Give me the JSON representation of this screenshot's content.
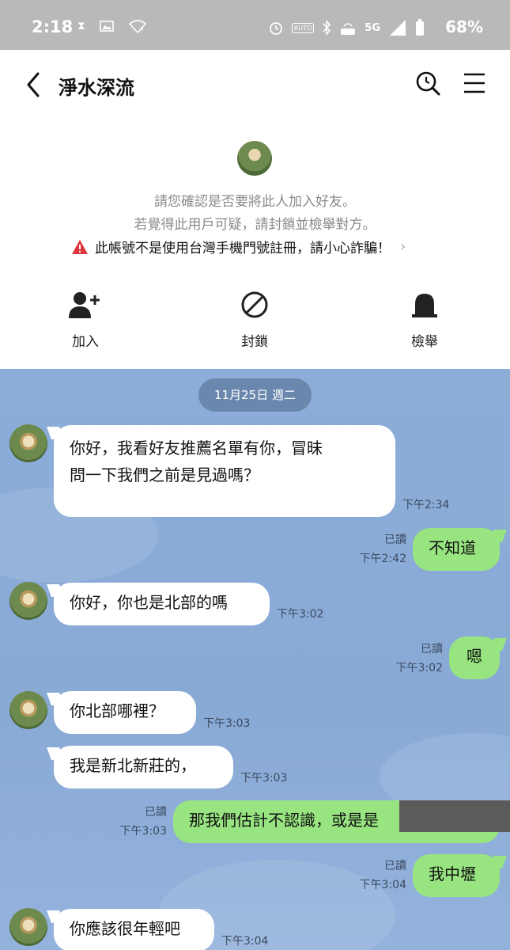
{
  "status_bar": {
    "time": "2:18",
    "battery": "68%",
    "icons": [
      "hourglass-icon",
      "image-icon",
      "wifi-question-icon",
      "alarm-icon",
      "auto-icon",
      "bluetooth-icon",
      "volte-icon",
      "5g-icon",
      "signal-icon",
      "battery-icon"
    ],
    "auto_label": "AUTO",
    "net_label": "5G"
  },
  "header": {
    "title": "淨水深流"
  },
  "friend_panel": {
    "confirm_line1": "請您確認是否要將此人加入好友。",
    "confirm_line2": "若覺得此用戶可疑，請封鎖並檢舉對方。",
    "warning": "此帳號不是使用台灣手機門號註冊，請小心詐騙！",
    "actions": [
      {
        "label": "加入",
        "icon": "add-friend-icon"
      },
      {
        "label": "封鎖",
        "icon": "block-icon"
      },
      {
        "label": "檢舉",
        "icon": "report-icon"
      }
    ]
  },
  "chat": {
    "date": "11月25日 週二",
    "messages": [
      {
        "side": "in",
        "text_line1": "你好，我看好友推薦名單有你，冒昧",
        "text_line2": "問一下我們之前是見過嗎？",
        "time": "下午2:34"
      },
      {
        "side": "out",
        "text": "不知道",
        "read": "已讀",
        "time": "下午2:42"
      },
      {
        "side": "in",
        "text": "你好，你也是北部的嗎",
        "time": "下午3:02"
      },
      {
        "side": "out",
        "text": "嗯",
        "read": "已讀",
        "time": "下午3:02"
      },
      {
        "side": "in",
        "text": "你北部哪裡？",
        "time": "下午3:03"
      },
      {
        "side": "in",
        "text": "我是新北新莊的，",
        "time": "下午3:03"
      },
      {
        "side": "out",
        "text": "那我們估計不認識，或是是",
        "read": "已讀",
        "time": "下午3:03"
      },
      {
        "side": "out",
        "text": "我中壢",
        "read": "已讀",
        "time": "下午3:04"
      },
      {
        "side": "in",
        "text": "你應該很年輕吧",
        "time": "下午3:04"
      }
    ]
  },
  "colors": {
    "chat_bg": "#8aaad6",
    "out_bubble": "#97e480",
    "in_bubble": "#ffffff",
    "status_bar": "#b9b9b9",
    "warning_red": "#e0343a"
  }
}
